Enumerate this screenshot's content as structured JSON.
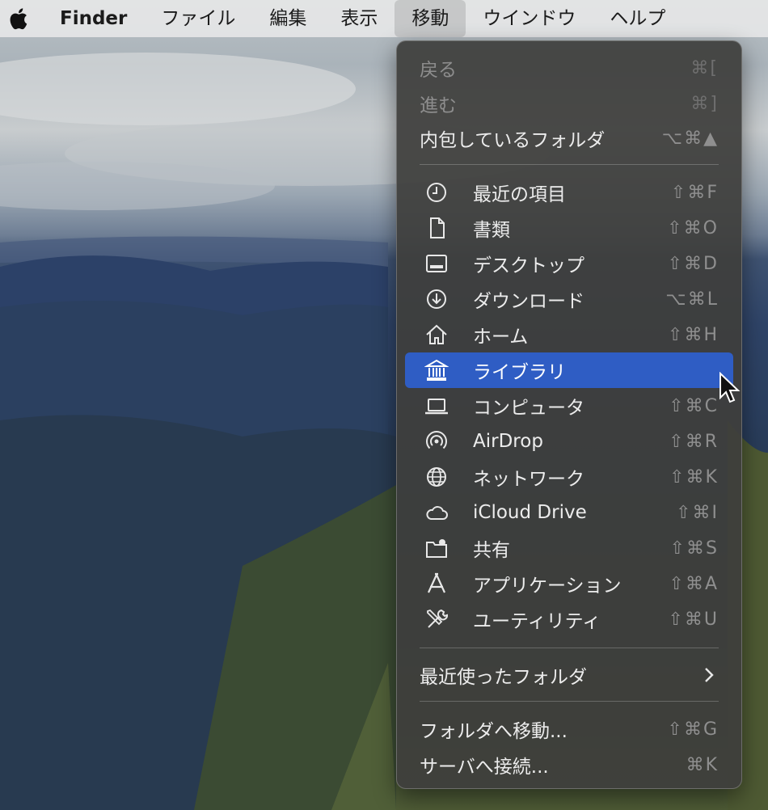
{
  "menubar": {
    "app_name": "Finder",
    "items": [
      "ファイル",
      "編集",
      "表示",
      "移動",
      "ウインドウ",
      "ヘルプ"
    ],
    "active_item": "移動"
  },
  "menu": {
    "top_items": [
      {
        "label": "戻る",
        "shortcut": "⌘[",
        "enabled": false
      },
      {
        "label": "進む",
        "shortcut": "⌘]",
        "enabled": false
      },
      {
        "label": "内包しているフォルダ",
        "shortcut": "⌥⌘▲",
        "enabled": true
      }
    ],
    "places": [
      {
        "label": "最近の項目",
        "shortcut": "⇧⌘F",
        "icon": "clock-icon"
      },
      {
        "label": "書類",
        "shortcut": "⇧⌘O",
        "icon": "document-icon"
      },
      {
        "label": "デスクトップ",
        "shortcut": "⇧⌘D",
        "icon": "desktop-icon"
      },
      {
        "label": "ダウンロード",
        "shortcut": "⌥⌘L",
        "icon": "download-icon"
      },
      {
        "label": "ホーム",
        "shortcut": "⇧⌘H",
        "icon": "home-icon"
      },
      {
        "label": "ライブラリ",
        "shortcut": "",
        "icon": "library-icon",
        "selected": true
      },
      {
        "label": "コンピュータ",
        "shortcut": "⇧⌘C",
        "icon": "laptop-icon"
      },
      {
        "label": "AirDrop",
        "shortcut": "⇧⌘R",
        "icon": "airdrop-icon"
      },
      {
        "label": "ネットワーク",
        "shortcut": "⇧⌘K",
        "icon": "globe-icon"
      },
      {
        "label": "iCloud Drive",
        "shortcut": "⇧⌘I",
        "icon": "cloud-icon"
      },
      {
        "label": "共有",
        "shortcut": "⇧⌘S",
        "icon": "shared-folder-icon"
      },
      {
        "label": "アプリケーション",
        "shortcut": "⇧⌘A",
        "icon": "applications-icon"
      },
      {
        "label": "ユーティリティ",
        "shortcut": "⇧⌘U",
        "icon": "utilities-icon"
      }
    ],
    "recent_folders": {
      "label": "最近使ったフォルダ"
    },
    "bottom_items": [
      {
        "label": "フォルダへ移動...",
        "shortcut": "⇧⌘G"
      },
      {
        "label": "サーバへ接続...",
        "shortcut": "⌘K"
      }
    ]
  },
  "colors": {
    "selection": "#2f5dc4",
    "menu_bg": "#3e3e3c"
  }
}
